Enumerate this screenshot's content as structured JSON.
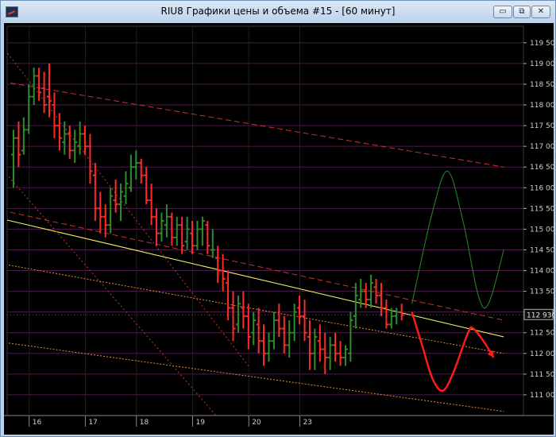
{
  "window": {
    "title": "RIU8 Графики цены и объема #15 - [60 минут]",
    "controls": {
      "minimize": "▭",
      "restore": "⧉",
      "close": "✕"
    }
  },
  "colors": {
    "background": "#000000",
    "bull": "#2e8b2e",
    "bear": "#ff2a2a",
    "trend_yellow": "#ffff66",
    "channel_red": "#c83232",
    "channel_orange": "#e09030",
    "forecast_green": "#1f7a1f",
    "forecast_red": "#ff1a1a"
  },
  "chart_data": {
    "type": "candlestick",
    "instrument": "RIU8",
    "timeframe": "60 минут",
    "y_ticks": [
      "119 500",
      "119 000",
      "118 500",
      "118 000",
      "117 500",
      "117 000",
      "116 500",
      "116 000",
      "115 500",
      "115 000",
      "114 500",
      "114 000",
      "113 500",
      "113 000",
      "112 500",
      "112 000",
      "111 500",
      "111 000"
    ],
    "y_tick_values": [
      119500,
      119000,
      118500,
      118000,
      117500,
      117000,
      116500,
      116000,
      115500,
      115000,
      114500,
      114000,
      113500,
      113000,
      112500,
      112000,
      111500,
      111000
    ],
    "ylim": [
      110500,
      119900
    ],
    "current_price": "112 930",
    "x_ticks": [
      "16",
      "17",
      "18",
      "19",
      "20",
      "23"
    ],
    "x_tick_bar_index": [
      4,
      15,
      25,
      36,
      47,
      57
    ],
    "bars": [
      [
        116800,
        117400,
        116000,
        117200
      ],
      [
        117200,
        117600,
        116500,
        116800
      ],
      [
        116900,
        117700,
        116800,
        117400
      ],
      [
        117400,
        118500,
        117300,
        118200
      ],
      [
        118200,
        118900,
        118000,
        118700
      ],
      [
        118700,
        118900,
        118100,
        118300
      ],
      [
        118400,
        118800,
        117800,
        118000
      ],
      [
        118200,
        119000,
        117700,
        118100
      ],
      [
        118000,
        118300,
        117200,
        117500
      ],
      [
        117500,
        117800,
        116900,
        117200
      ],
      [
        117100,
        117600,
        116800,
        117300
      ],
      [
        117300,
        117500,
        116700,
        116900
      ],
      [
        116900,
        117400,
        116600,
        117100
      ],
      [
        117000,
        117600,
        116800,
        117300
      ],
      [
        117300,
        117500,
        116800,
        117000
      ],
      [
        117000,
        117300,
        116100,
        116400
      ],
      [
        116300,
        116600,
        115200,
        115500
      ],
      [
        115500,
        115900,
        114900,
        115300
      ],
      [
        115300,
        115600,
        114800,
        115100
      ],
      [
        115100,
        116000,
        114900,
        115800
      ],
      [
        115700,
        116200,
        115400,
        115600
      ],
      [
        115600,
        116100,
        115200,
        115900
      ],
      [
        115800,
        116400,
        115600,
        116100
      ],
      [
        116000,
        116800,
        115900,
        116500
      ],
      [
        116500,
        116900,
        116200,
        116600
      ],
      [
        116600,
        116700,
        116100,
        116300
      ],
      [
        116300,
        116500,
        115600,
        115700
      ],
      [
        115700,
        116100,
        115100,
        115300
      ],
      [
        115300,
        115500,
        114600,
        114900
      ],
      [
        114900,
        115400,
        114700,
        115200
      ],
      [
        115100,
        115600,
        114800,
        115300
      ],
      [
        115300,
        115400,
        114600,
        114800
      ],
      [
        114800,
        115300,
        114600,
        115100
      ],
      [
        115100,
        115300,
        114400,
        114600
      ],
      [
        114700,
        115300,
        114500,
        115000
      ],
      [
        114900,
        115200,
        114400,
        114600
      ],
      [
        114600,
        115200,
        114500,
        115000
      ],
      [
        115000,
        115300,
        114600,
        115200
      ],
      [
        115100,
        115200,
        114400,
        114600
      ],
      [
        114500,
        115000,
        114300,
        114500
      ],
      [
        114300,
        114600,
        113700,
        114000
      ],
      [
        114000,
        114400,
        113500,
        113800
      ],
      [
        113700,
        114000,
        112800,
        113100
      ],
      [
        113100,
        113500,
        112300,
        112600
      ],
      [
        112700,
        113400,
        112500,
        113200
      ],
      [
        113100,
        113500,
        112600,
        112900
      ],
      [
        112900,
        113200,
        112100,
        112400
      ],
      [
        112500,
        113000,
        112200,
        112800
      ],
      [
        112700,
        113100,
        112000,
        112300
      ],
      [
        112300,
        112700,
        111700,
        112000
      ],
      [
        112000,
        112500,
        111800,
        112300
      ],
      [
        112300,
        113000,
        112100,
        112800
      ],
      [
        112800,
        113200,
        112400,
        112600
      ],
      [
        112600,
        112900,
        112000,
        112200
      ],
      [
        112200,
        112800,
        111900,
        112500
      ],
      [
        112500,
        113200,
        112300,
        113000
      ],
      [
        113100,
        113400,
        112700,
        112900
      ],
      [
        112900,
        113300,
        112300,
        112500
      ],
      [
        112400,
        112800,
        111600,
        112000
      ],
      [
        112000,
        112600,
        111600,
        112400
      ],
      [
        112300,
        112700,
        111800,
        112100
      ],
      [
        112100,
        112500,
        111500,
        111900
      ],
      [
        111900,
        112400,
        111600,
        112200
      ],
      [
        112200,
        112500,
        111800,
        112000
      ],
      [
        112000,
        112300,
        111700,
        111900
      ],
      [
        111900,
        112200,
        111700,
        112100
      ],
      [
        112000,
        113000,
        111800,
        112800
      ],
      [
        112900,
        113700,
        112600,
        113400
      ],
      [
        113300,
        113800,
        113100,
        113500
      ],
      [
        113500,
        113700,
        113100,
        113300
      ],
      [
        113300,
        113900,
        113100,
        113700
      ],
      [
        113600,
        113800,
        113200,
        113400
      ],
      [
        113400,
        113700,
        112900,
        113100
      ],
      [
        113100,
        113300,
        112600,
        112700
      ],
      [
        112700,
        113100,
        112600,
        112900
      ],
      [
        112900,
        113100,
        112700,
        113000
      ],
      [
        113000,
        113200,
        112800,
        112930
      ]
    ],
    "lines": [
      {
        "color": "trend_yellow",
        "dash": "",
        "points": [
          [
            -4,
            115300
          ],
          [
            96,
            112400
          ]
        ]
      },
      {
        "color": "channel_red",
        "dash": "7,4",
        "points": [
          [
            -4,
            118600
          ],
          [
            96,
            116500
          ]
        ]
      },
      {
        "color": "channel_red",
        "dash": "7,4",
        "points": [
          [
            -4,
            115500
          ],
          [
            96,
            112800
          ]
        ]
      },
      {
        "color": "channel_orange",
        "dash": "2,2",
        "points": [
          [
            -4,
            114200
          ],
          [
            96,
            112000
          ]
        ]
      },
      {
        "color": "channel_orange",
        "dash": "2,2",
        "points": [
          [
            -4,
            112300
          ],
          [
            96,
            110600
          ]
        ]
      },
      {
        "color": "channel_red",
        "dash": "2,3",
        "points": [
          [
            -4,
            119700
          ],
          [
            46,
            111700
          ]
        ]
      },
      {
        "color": "channel_red",
        "dash": "2,3",
        "points": [
          [
            -4,
            116700
          ],
          [
            46,
            109600
          ]
        ]
      }
    ],
    "forecast_up": [
      [
        78,
        113200
      ],
      [
        82,
        115400
      ],
      [
        85,
        116400
      ],
      [
        88,
        115200
      ],
      [
        91,
        113400
      ],
      [
        93,
        113200
      ],
      [
        96,
        114500
      ]
    ],
    "forecast_down": [
      [
        78,
        113000
      ],
      [
        80,
        112200
      ],
      [
        82,
        111400
      ],
      [
        84,
        111100
      ],
      [
        86,
        111500
      ],
      [
        89,
        112500
      ],
      [
        90,
        112600
      ],
      [
        92,
        112300
      ],
      [
        94,
        111900
      ]
    ]
  }
}
